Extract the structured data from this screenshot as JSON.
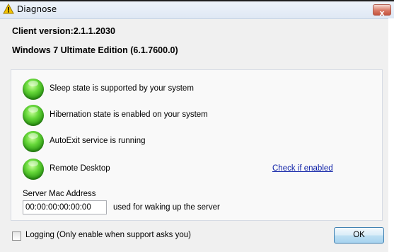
{
  "window": {
    "title": "Diagnose",
    "close_label": "x",
    "title_icon": "warning-icon"
  },
  "info": {
    "client_version": "Client version:2.1.1.2030",
    "os_version": "Windows 7 Ultimate Edition (6.1.7600.0)"
  },
  "status": {
    "items": [
      {
        "label": "Sleep state is supported by your system",
        "state": "ok",
        "color": "#3cb521"
      },
      {
        "label": "Hibernation state is enabled on your system",
        "state": "ok",
        "color": "#3cb521"
      },
      {
        "label": "AutoExit service is running",
        "state": "ok",
        "color": "#3cb521"
      },
      {
        "label": "Remote Desktop",
        "state": "ok",
        "color": "#3cb521"
      }
    ],
    "check_link": "Check if enabled"
  },
  "server": {
    "mac_label": "Server Mac Address",
    "mac_value": "00:00:00:00:00:00",
    "mac_hint": "used for waking up the server"
  },
  "footer": {
    "logging_label": "Logging (Only enable when support asks you)",
    "logging_checked": false,
    "ok_label": "OK"
  }
}
